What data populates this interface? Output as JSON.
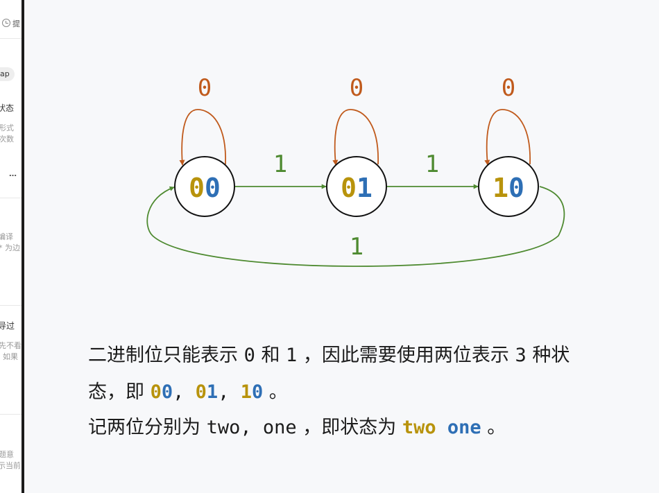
{
  "sidebar": {
    "header_fragment": "提",
    "chip_fragment": "ap",
    "item1_title": "状态",
    "item1_line1": "形式",
    "item1_line2": "次数",
    "more_label": "…",
    "item2_line1": "编译",
    "item2_line2": "* 为边",
    "item3_title": "导过",
    "item3_line1": "先不看",
    "item3_line2": "如果",
    "item4_line1": "题意",
    "item4_line2": "示当前"
  },
  "colors": {
    "self_loop": "#c05a1c",
    "transition": "#4e8a30",
    "bit_gold": "#b8930c",
    "bit_blue": "#2e6fb5"
  },
  "diagram": {
    "states": [
      {
        "id": "s00",
        "bit_high": "0",
        "bit_low": "0"
      },
      {
        "id": "s01",
        "bit_high": "0",
        "bit_low": "1"
      },
      {
        "id": "s10",
        "bit_high": "1",
        "bit_low": "0"
      }
    ],
    "self_loop_labels": [
      "0",
      "0",
      "0"
    ],
    "edge_labels": [
      "1",
      "1"
    ],
    "return_edge_label": "1"
  },
  "text": {
    "line1_a": "二进制位只能表示 ",
    "line1_b": "0",
    "line1_c": " 和 ",
    "line1_d": "1",
    "line1_e": " ，因此需要使用两位表示 ",
    "line1_f": "3",
    "line1_g": " 种状",
    "line2_a": "态，即 ",
    "line2_s1_high": "0",
    "line2_s1_low": "0",
    "line2_sep1": ", ",
    "line2_s2_high": "0",
    "line2_s2_low": "1",
    "line2_sep2": ", ",
    "line2_s3_high": "1",
    "line2_s3_low": "0",
    "line2_end": " 。",
    "line3_a": "记两位分别为 ",
    "line3_b": "two, one",
    "line3_c": " ，即状态为 ",
    "line3_two": "two",
    "line3_space": " ",
    "line3_one": "one",
    "line3_end": " 。"
  }
}
